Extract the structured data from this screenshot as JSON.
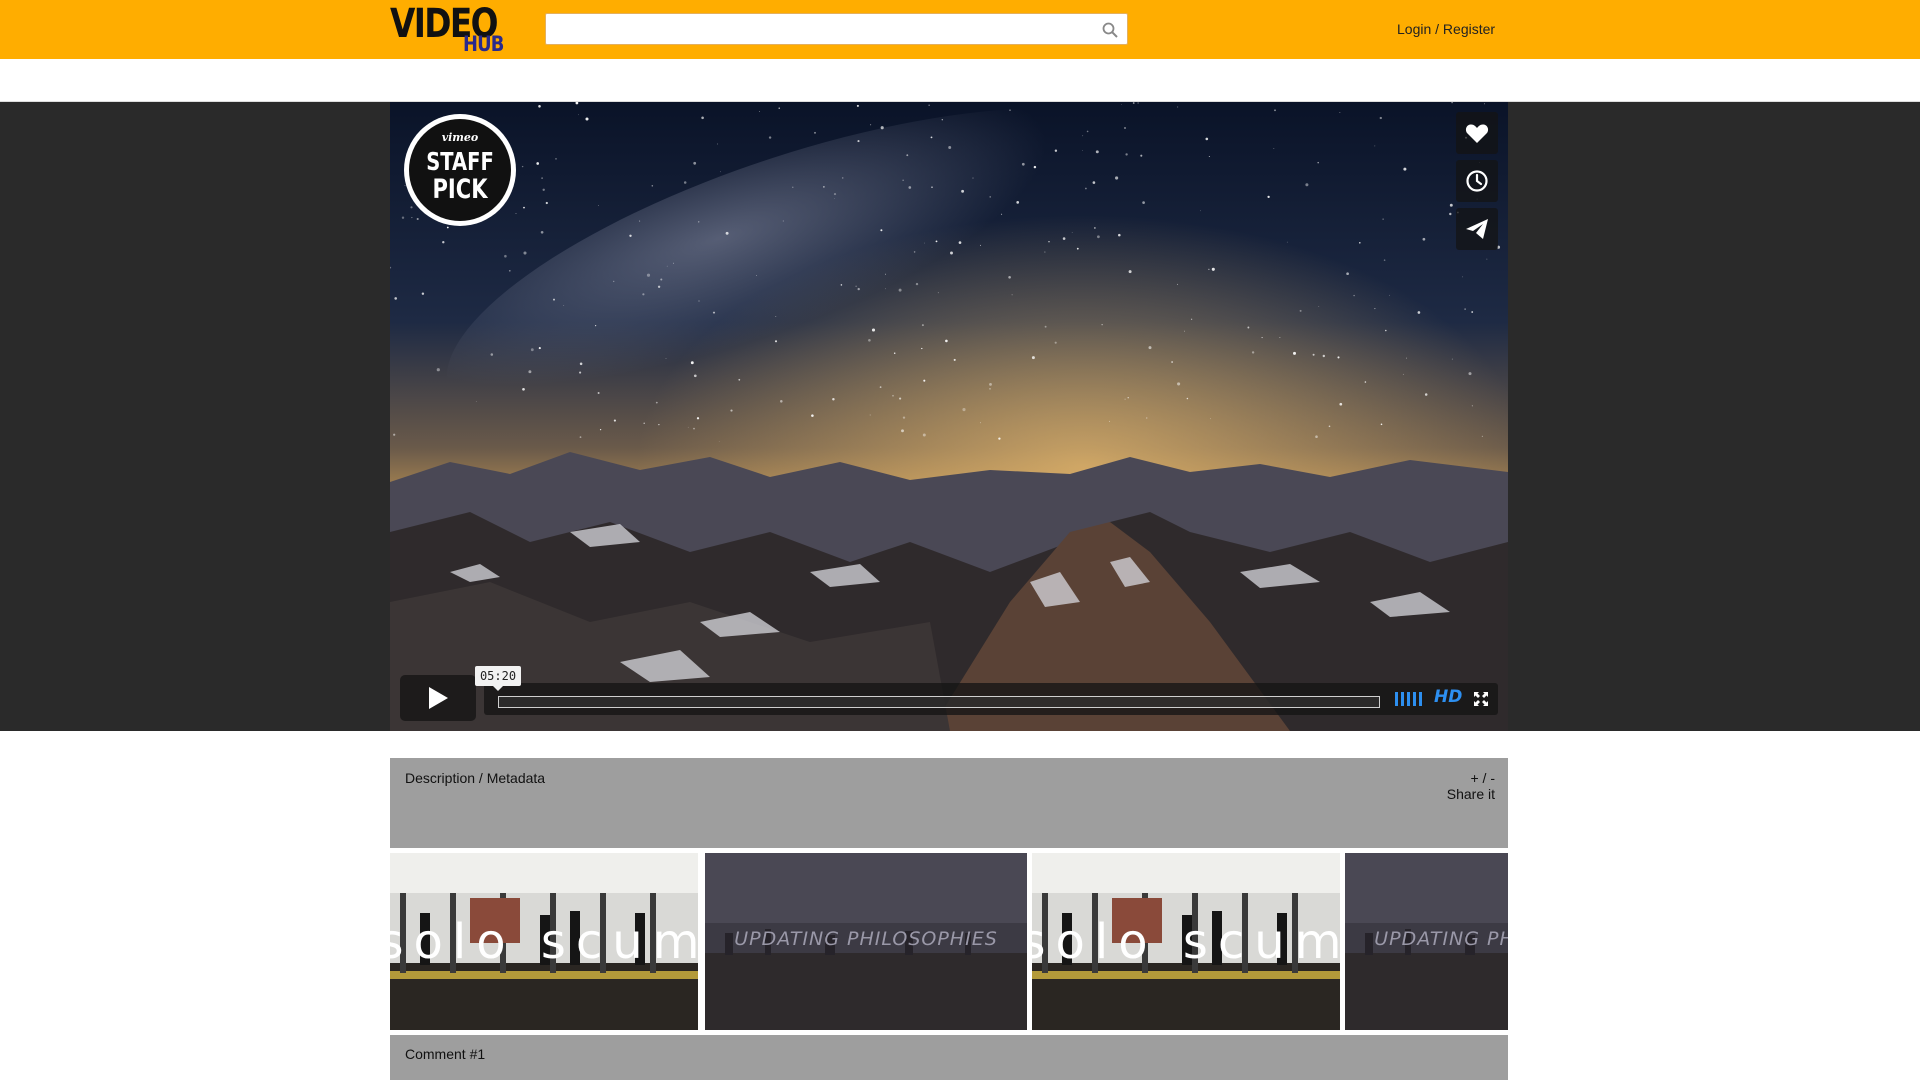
{
  "header": {
    "logo_top": "VIDEO",
    "logo_bottom": "HUB",
    "search_placeholder": "",
    "search_icon": "search-icon",
    "auth_label": "Login / Register"
  },
  "player": {
    "badge_top": "vimeo",
    "badge_line1": "STAFF",
    "badge_line2": "PICK",
    "side_buttons": [
      "heart-icon",
      "clock-icon",
      "send-icon"
    ],
    "time": "05:20",
    "progress": 0.0,
    "hd_label": "HD"
  },
  "description": {
    "title": "Description / Metadata",
    "toggle_label": "+ / -",
    "share_label": "Share it"
  },
  "thumbnails": [
    {
      "title": "solo scum"
    },
    {
      "title": "UPDATING PHILOSOPHIES"
    },
    {
      "title": "solo scum"
    },
    {
      "title": "UPDATING PHILOSOPHIES"
    }
  ],
  "comments": {
    "first_title": "Comment #1"
  },
  "colors": {
    "header_bg": "#ffad00",
    "stage_bg": "#2a2a2a",
    "panel_bg": "#9e9e9e",
    "hd_color": "#2d8ff0"
  }
}
